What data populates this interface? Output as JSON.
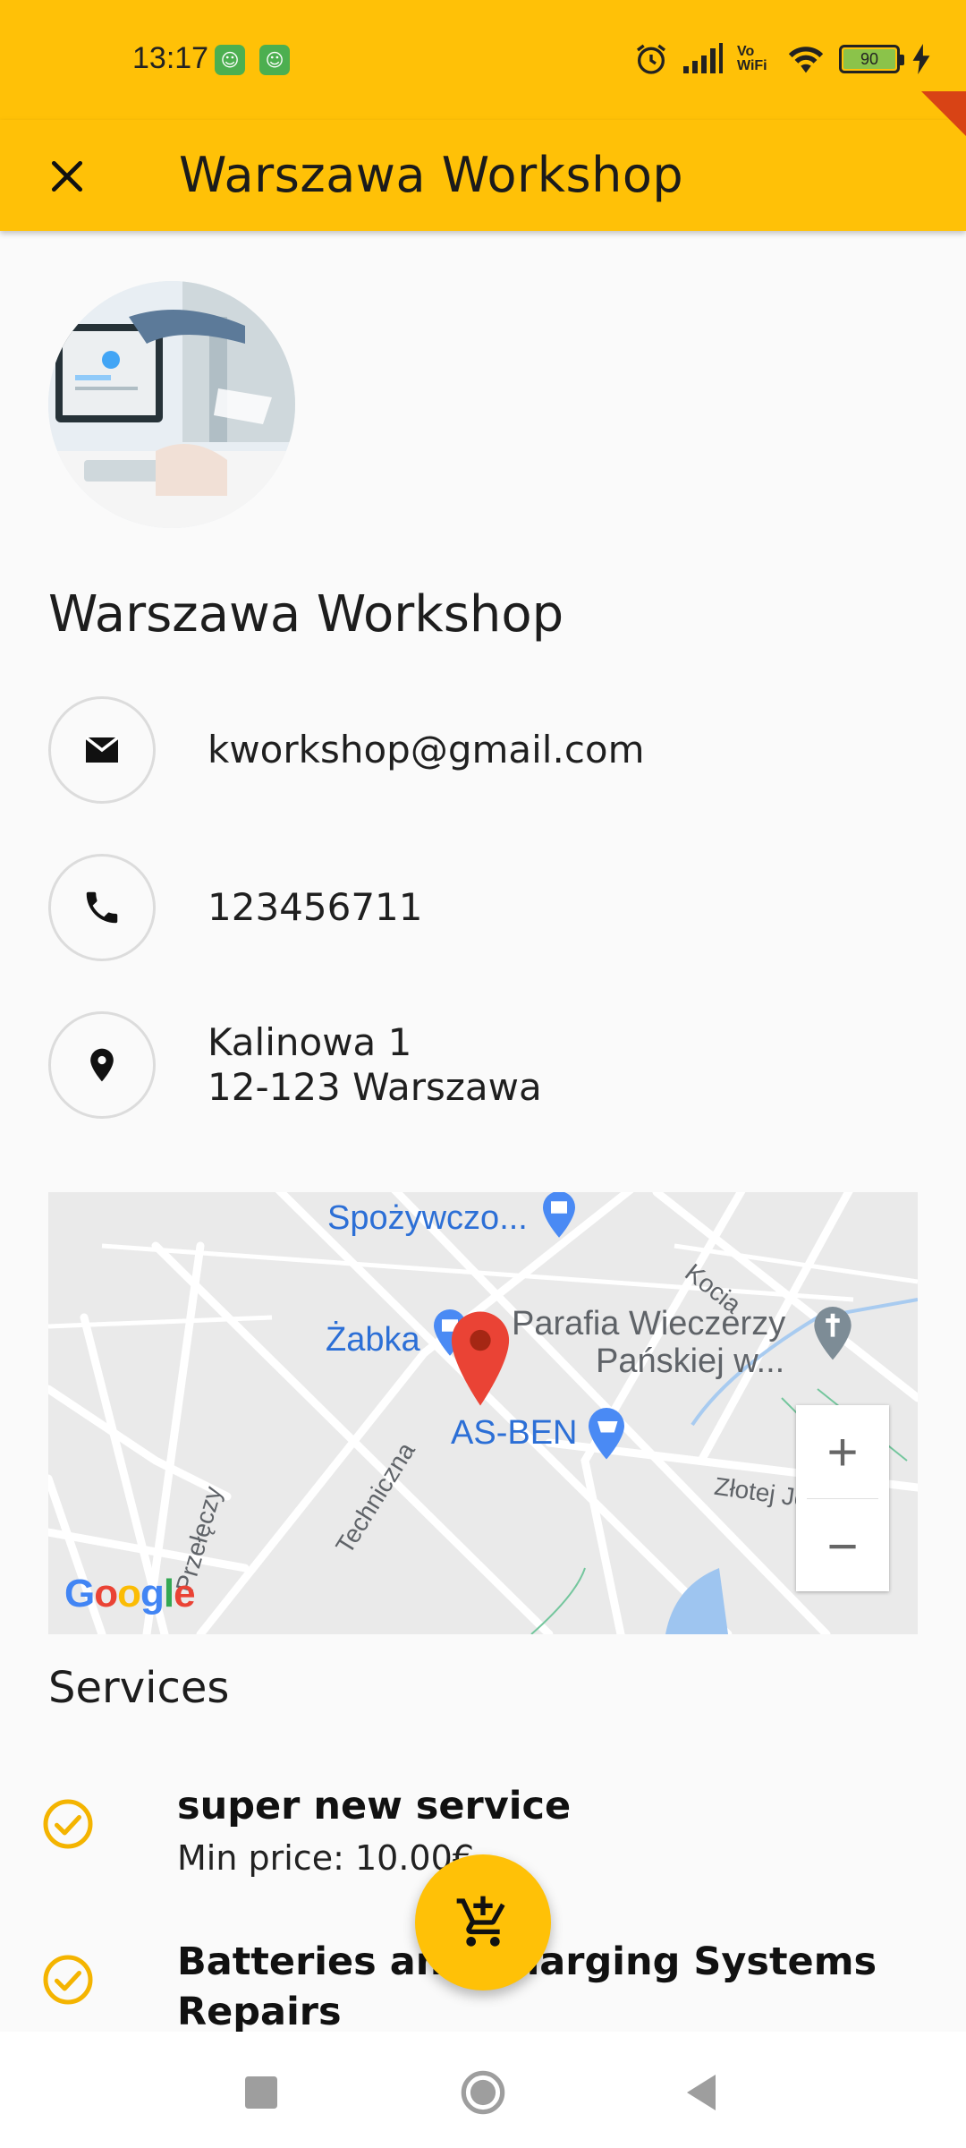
{
  "status_bar": {
    "time": "13:17",
    "battery_level": "90",
    "network_label": "Vo WiFi",
    "icons": [
      "alarm-icon",
      "signal-icon",
      "wifi-icon",
      "battery-icon",
      "charging-icon"
    ]
  },
  "app_bar": {
    "title": "Warszawa Workshop",
    "close_icon": "close-icon"
  },
  "workshop": {
    "name": "Warszawa Workshop",
    "email": "kworkshop@gmail.com",
    "phone": "123456711",
    "address_line1": "Kalinowa 1",
    "address_line2": "12-123 Warszawa"
  },
  "map": {
    "labels": {
      "spozywczo": "Spożywczo...",
      "zabka": "Żabka",
      "parafia_line1": "Parafia Wieczerzy",
      "parafia_line2": "Pańskiej w...",
      "asben": "AS-BEN",
      "kocia": "Kocia",
      "techniczna": "Techniczna",
      "przelęczy": "Przełęczy",
      "zlotej": "Złotej Jesieni"
    },
    "zoom_in": "+",
    "zoom_out": "−",
    "provider": "Google"
  },
  "services": {
    "title": "Services",
    "items": [
      {
        "name": "super new service",
        "price": "Min price: 10.00€"
      },
      {
        "name": "Batteries and Charging Systems Repairs",
        "price": ""
      }
    ]
  },
  "colors": {
    "accent": "#ffc107",
    "check": "#f4b400",
    "pin": "#ea4335",
    "map_label": "#2c6fd6"
  }
}
